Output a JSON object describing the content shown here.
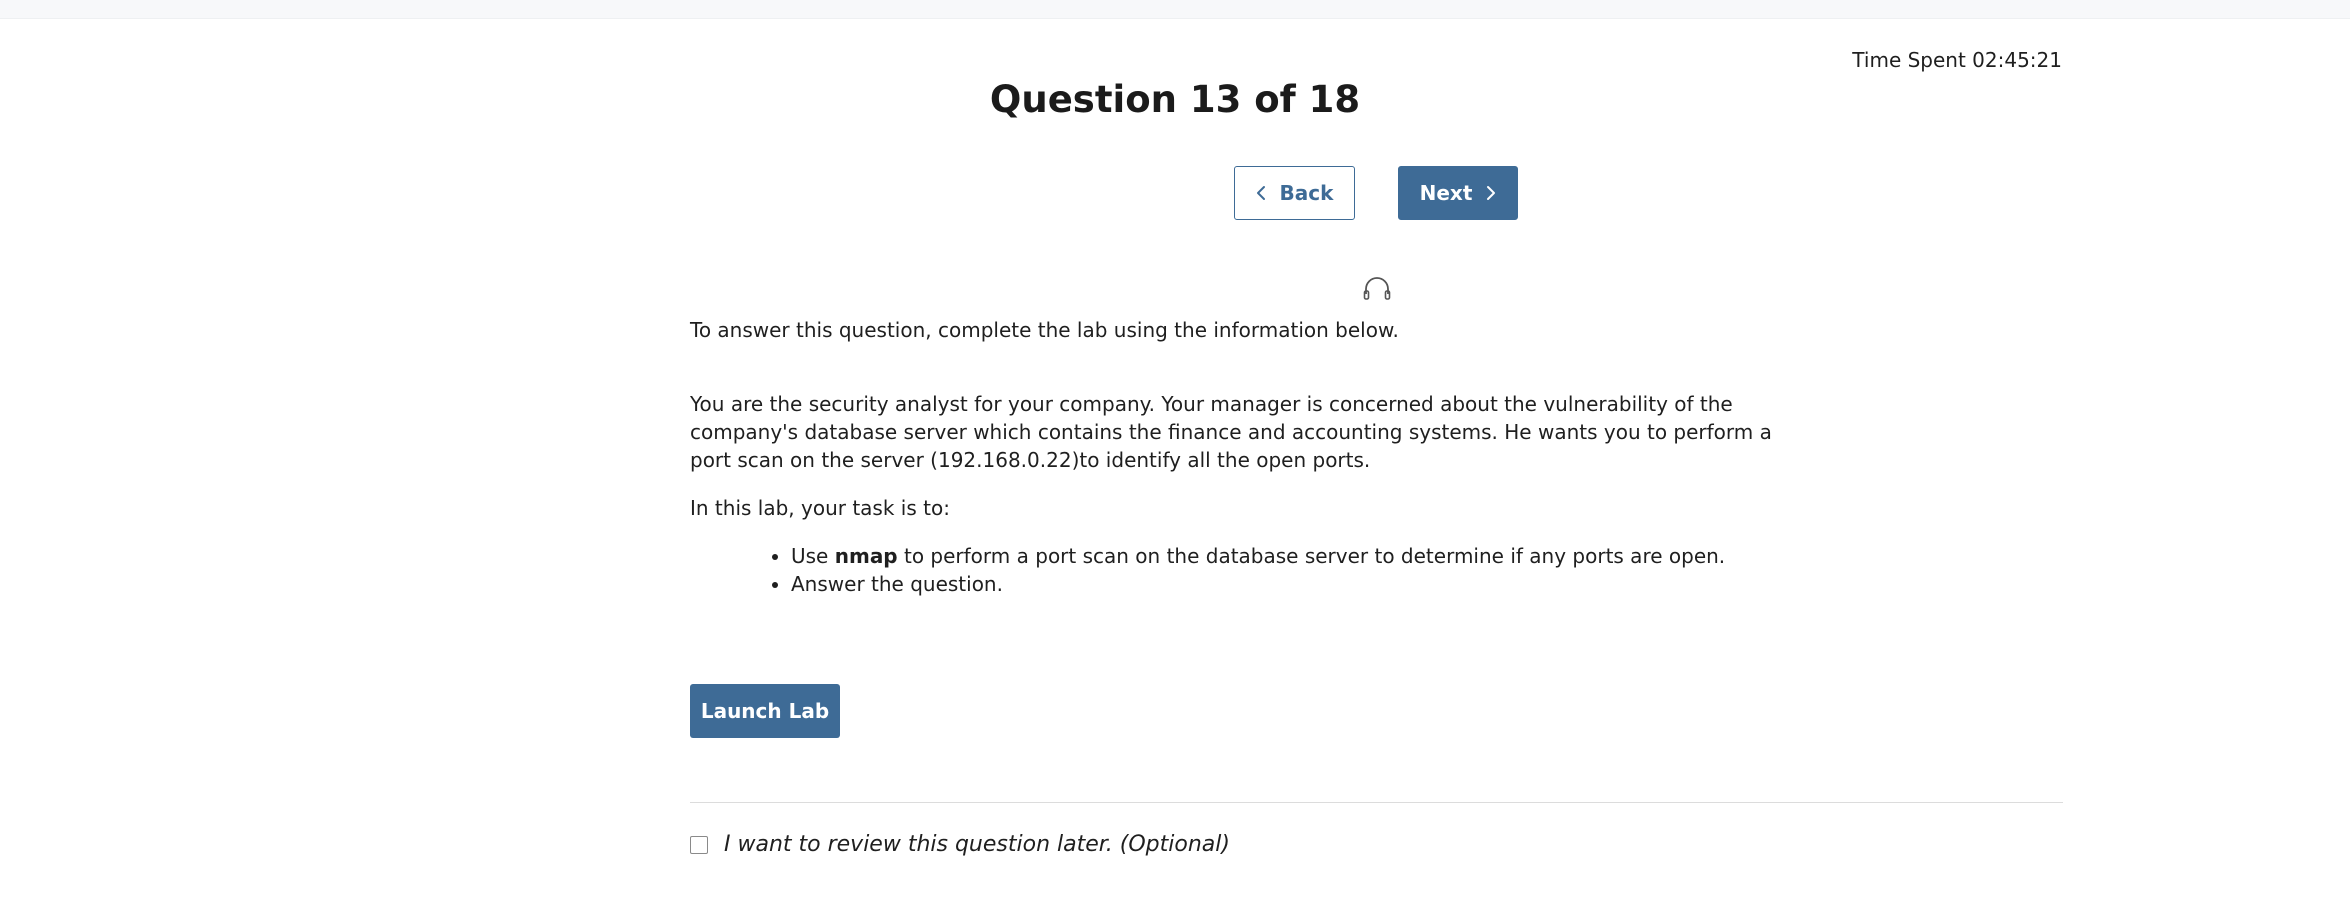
{
  "header": {
    "timer_label": "Time Spent",
    "timer_value": "02:45:21",
    "title": "Question 13 of 18"
  },
  "nav": {
    "back_label": "Back",
    "next_label": "Next",
    "back_icon": "chevron-left-icon",
    "next_icon": "chevron-right-icon"
  },
  "audio": {
    "icon": "headphones-icon"
  },
  "content": {
    "intro": "To answer this question, complete the lab using the information below.",
    "scenario": "You are the security analyst for your company. Your manager is concerned about the vulnerability of the company's database server which contains the finance and accounting systems. He wants you to perform a port scan on the server (192.168.0.22)to identify all the open ports.",
    "task_intro": "In this lab, your task is to:",
    "tasks": [
      {
        "prefix": "Use ",
        "bold": "nmap",
        "suffix": " to perform a port scan on the database server to determine if any ports are open."
      },
      {
        "text": "Answer the question."
      }
    ]
  },
  "launch": {
    "label": "Launch Lab"
  },
  "review": {
    "checked": false,
    "label": "I want to review this question later. (Optional)"
  },
  "colors": {
    "accent": "#3e6b96",
    "text": "#1f1f1f",
    "divider": "#dcdcdc"
  }
}
